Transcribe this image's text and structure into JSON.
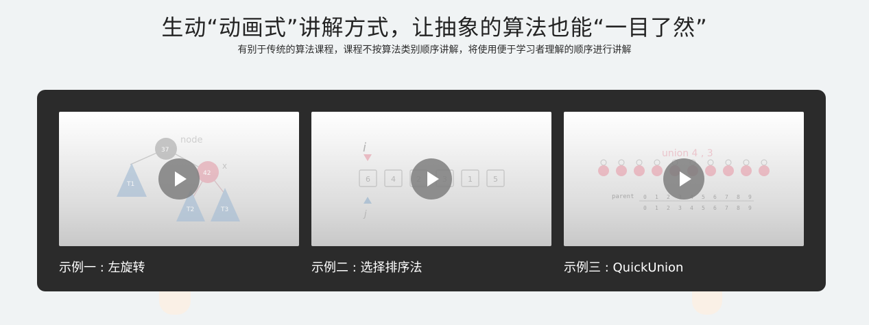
{
  "hero": {
    "title": "生动“动画式”讲解方式，让抽象的算法也能“一目了然”",
    "subtitle": "有别于传统的算法课程，课程不按算法类别顺序讲解，将使用便于学习者理解的顺序进行讲解"
  },
  "colors": {
    "page_background": "#f0f3f4",
    "panel_background": "#2b2b2b",
    "caption_text": "#ffffff",
    "play_button": "#7f7f7f"
  },
  "examples": [
    {
      "caption": "示例一 : 左旋转",
      "icon": "play-icon",
      "thumbnail_labels": {
        "node": "node",
        "x": "x",
        "n37": "37",
        "n42": "42",
        "t1": "T1",
        "t2": "T2",
        "t3": "T3"
      }
    },
    {
      "caption": "示例二 : 选择排序法",
      "icon": "play-icon",
      "thumbnail_labels": {
        "i": "i",
        "j": "j",
        "values": [
          "6",
          "4",
          "2",
          "3",
          "1",
          "5"
        ]
      }
    },
    {
      "caption": "示例三 : QuickUnion",
      "icon": "play-icon",
      "thumbnail_labels": {
        "union": "union 4 , 3",
        "parent": "parent",
        "indices": [
          "0",
          "1",
          "2",
          "3",
          "4",
          "5",
          "6",
          "7",
          "8",
          "9"
        ],
        "parents": [
          "0",
          "1",
          "2",
          "3",
          "4",
          "5",
          "6",
          "7",
          "8",
          "9"
        ]
      }
    }
  ]
}
